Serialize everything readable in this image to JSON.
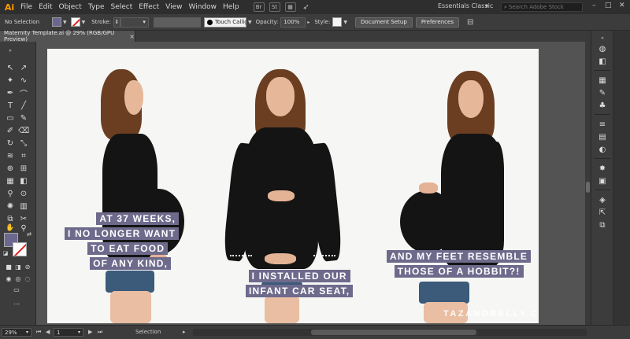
{
  "app": {
    "logo": "Ai"
  },
  "menu": [
    "File",
    "Edit",
    "Object",
    "Type",
    "Select",
    "Effect",
    "View",
    "Window",
    "Help"
  ],
  "menu_icons": [
    {
      "icon": "bridge-icon",
      "label": "Br"
    },
    {
      "icon": "stock-icon",
      "label": "St"
    },
    {
      "icon": "grid-layout-icon",
      "label": ""
    },
    {
      "icon": "sync-icon",
      "label": ""
    }
  ],
  "workspace": {
    "label": "Essentials Classic"
  },
  "search": {
    "placeholder": "Search Adobe Stock"
  },
  "window_controls": [
    "–",
    "□",
    "✕"
  ],
  "controlbar": {
    "selection_label": "No Selection",
    "fill_color": "#6b6890",
    "stroke_label": "Stroke:",
    "brush_label": "Touch Callig...",
    "opacity_label": "Opacity:",
    "opacity_value": "100%",
    "style_label": "Style:",
    "document_setup": "Document Setup",
    "preferences": "Preferences"
  },
  "tab": {
    "title": "Maternity Template.ai @ 29% (RGB/GPU Preview)",
    "close": "×"
  },
  "artboard": {
    "captions": {
      "left": [
        "AT 37 WEEKS,",
        "I NO LONGER WANT",
        "TO EAT FOOD",
        "OF ANY KIND,"
      ],
      "center": [
        "I INSTALLED OUR",
        "INFANT CAR SEAT,"
      ],
      "right": [
        "AND MY FEET RESEMBLE",
        "THOSE OF A HOBBIT?!"
      ]
    },
    "watermark": "TAZANDBELLY.COM",
    "caption_color": "#6e6a8c"
  },
  "statusbar": {
    "zoom": "29%",
    "artboard_number": "1",
    "tool": "Selection"
  }
}
